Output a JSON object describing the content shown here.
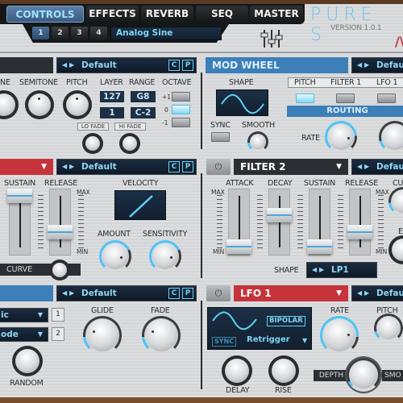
{
  "tabs": [
    "CONTROLS",
    "EFFECTS",
    "REVERB",
    "SEQ",
    "MASTER"
  ],
  "active_tab": "CONTROLS",
  "layer_buttons": [
    "1",
    "2",
    "3",
    "4"
  ],
  "active_layer": "1",
  "patch_name": "Analog Sine",
  "brand": {
    "logo": "PURE S",
    "version": "VERSION 1.0.1",
    "accent": "#4fc3f7",
    "red": "#c5343a"
  },
  "preset": {
    "name": "Default",
    "copy": "C",
    "paste": "P"
  },
  "osc": {
    "labels": [
      "NE",
      "SEMITONE",
      "PITCH",
      "LAYER",
      "RANGE",
      "OCTAVE"
    ],
    "layer_hi": "127",
    "layer_lo": "1",
    "range_hi": "G8",
    "range_lo": "C-2",
    "octave": [
      "+1",
      "0",
      "-1"
    ],
    "octave_selected": "0",
    "lo_fade": "LO FADE",
    "hi_fade": "HI FADE"
  },
  "modwheel": {
    "title": "MOD WHEEL",
    "shape": "SHAPE",
    "sync": "SYNC",
    "smooth": "SMOOTH",
    "targets": [
      "PITCH",
      "FILTER 1",
      "LFO 1"
    ],
    "target_active": "PITCH",
    "routing": "ROUTING",
    "rate": "RATE"
  },
  "env1": {
    "sustain": "SUSTAIN",
    "release": "RELEASE",
    "max": "MAX",
    "min": "MIN",
    "curve": "CURVE",
    "velocity": "VELOCITY",
    "amount": "AMOUNT",
    "sensitivity": "SENSITIVITY",
    "sustain_level": 0.95,
    "release_level": 0.4
  },
  "filter2": {
    "title": "FILTER 2",
    "attack": "ATTACK",
    "decay": "DECAY",
    "sustain": "SUSTAIN",
    "release": "RELEASE",
    "cu": "CU",
    "e": "E",
    "max": "MAX",
    "min": "MIN",
    "shape_label": "SHAPE",
    "shape": "LP1",
    "attack_level": 0.0,
    "decay_level": 0.6,
    "sustain_level": 0.0,
    "release_level": 0.4
  },
  "voice": {
    "mode1": "ic",
    "mode2": "ode",
    "idx1": "1",
    "idx2": "2",
    "glide": "GLIDE",
    "fade": "FADE",
    "random": "RANDOM"
  },
  "lfo1": {
    "title": "LFO 1",
    "bipolar": "BIPOLAR",
    "sync": "SYNC",
    "trigger": "Retrigger",
    "rate": "RATE",
    "pitch": "PITCH",
    "delay": "DELAY",
    "rise": "RISE",
    "depth": "DEPTH",
    "smooth": "SMO"
  }
}
